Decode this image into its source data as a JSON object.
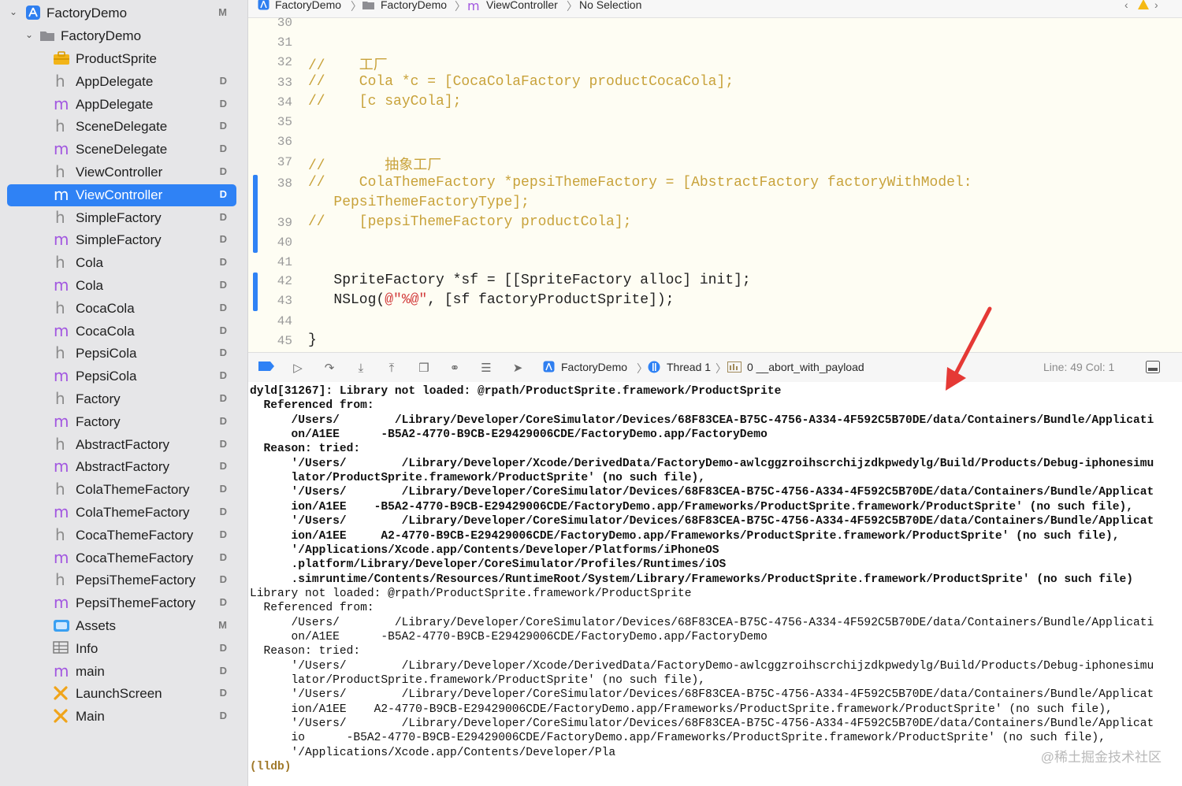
{
  "sidebar": {
    "project": {
      "label": "FactoryDemo",
      "status": "M"
    },
    "group": {
      "label": "FactoryDemo"
    },
    "items": [
      {
        "label": "ProductSprite",
        "kind": "framework",
        "status": ""
      },
      {
        "label": "AppDelegate",
        "kind": "h",
        "status": "D"
      },
      {
        "label": "AppDelegate",
        "kind": "m",
        "status": "D"
      },
      {
        "label": "SceneDelegate",
        "kind": "h",
        "status": "D"
      },
      {
        "label": "SceneDelegate",
        "kind": "m",
        "status": "D"
      },
      {
        "label": "ViewController",
        "kind": "h",
        "status": "D"
      },
      {
        "label": "ViewController",
        "kind": "m",
        "status": "D",
        "selected": true
      },
      {
        "label": "SimpleFactory",
        "kind": "h",
        "status": "D"
      },
      {
        "label": "SimpleFactory",
        "kind": "m",
        "status": "D"
      },
      {
        "label": "Cola",
        "kind": "h",
        "status": "D"
      },
      {
        "label": "Cola",
        "kind": "m",
        "status": "D"
      },
      {
        "label": "CocaCola",
        "kind": "h",
        "status": "D"
      },
      {
        "label": "CocaCola",
        "kind": "m",
        "status": "D"
      },
      {
        "label": "PepsiCola",
        "kind": "h",
        "status": "D"
      },
      {
        "label": "PepsiCola",
        "kind": "m",
        "status": "D"
      },
      {
        "label": "Factory",
        "kind": "h",
        "status": "D"
      },
      {
        "label": "Factory",
        "kind": "m",
        "status": "D"
      },
      {
        "label": "AbstractFactory",
        "kind": "h",
        "status": "D"
      },
      {
        "label": "AbstractFactory",
        "kind": "m",
        "status": "D"
      },
      {
        "label": "ColaThemeFactory",
        "kind": "h",
        "status": "D"
      },
      {
        "label": "ColaThemeFactory",
        "kind": "m",
        "status": "D"
      },
      {
        "label": "CocaThemeFactory",
        "kind": "h",
        "status": "D"
      },
      {
        "label": "CocaThemeFactory",
        "kind": "m",
        "status": "D"
      },
      {
        "label": "PepsiThemeFactory",
        "kind": "h",
        "status": "D"
      },
      {
        "label": "PepsiThemeFactory",
        "kind": "m",
        "status": "D"
      },
      {
        "label": "Assets",
        "kind": "assets",
        "status": "M"
      },
      {
        "label": "Info",
        "kind": "plist",
        "status": "D"
      },
      {
        "label": "main",
        "kind": "m",
        "status": "D"
      },
      {
        "label": "LaunchScreen",
        "kind": "storyboard",
        "status": "D"
      },
      {
        "label": "Main",
        "kind": "storyboard",
        "status": "D"
      }
    ]
  },
  "jumpbar": {
    "crumbs": [
      "FactoryDemo",
      "FactoryDemo",
      "ViewController",
      "No Selection"
    ]
  },
  "editor": {
    "lines": [
      {
        "num": "30",
        "code": ""
      },
      {
        "num": "31",
        "code": ""
      },
      {
        "num": "32",
        "code": "//    工厂",
        "comment": true
      },
      {
        "num": "33",
        "code": "//    Cola *c = [CocaColaFactory productCocaCola];",
        "comment": true
      },
      {
        "num": "34",
        "code": "//    [c sayCola];",
        "comment": true
      },
      {
        "num": "35",
        "code": ""
      },
      {
        "num": "36",
        "code": ""
      },
      {
        "num": "37",
        "code": "//       抽象工厂",
        "comment": true
      },
      {
        "num": "38",
        "code": "//    ColaThemeFactory *pepsiThemeFactory = [AbstractFactory factoryWithModel:",
        "comment": true
      },
      {
        "num": "",
        "code": "   PepsiThemeFactoryType];",
        "comment": true
      },
      {
        "num": "39",
        "code": "//    [pepsiThemeFactory productCola];",
        "comment": true
      },
      {
        "num": "40",
        "code": ""
      },
      {
        "num": "41",
        "code": ""
      },
      {
        "num": "42",
        "code": "   SpriteFactory *sf = [[SpriteFactory alloc] init];"
      },
      {
        "num": "43",
        "code_pre": "   NSLog(",
        "code_str": "@\"%@\"",
        "code_post": ", [sf factoryProductSprite]);"
      },
      {
        "num": "44",
        "code": ""
      },
      {
        "num": "45",
        "code": "}"
      }
    ]
  },
  "debugbar": {
    "target": "FactoryDemo",
    "thread": "Thread 1",
    "frame": "0 __abort_with_payload",
    "position": "Line: 49  Col: 1"
  },
  "console": {
    "lines": [
      {
        "t": "dyld[31267]: Library not loaded: @rpath/ProductSprite.framework/ProductSprite",
        "b": true
      },
      {
        "t": "  Referenced from:",
        "b": true
      },
      {
        "t": "      /Users/        /Library/Developer/CoreSimulator/Devices/68F83CEA-B75C-4756-A334-4F592C5B70DE/data/Containers/Bundle/Applicati",
        "b": true
      },
      {
        "t": "      on/A1EE      -B5A2-4770-B9CB-E29429006CDE/FactoryDemo.app/FactoryDemo",
        "b": true
      },
      {
        "t": "  Reason: tried:",
        "b": true
      },
      {
        "t": "      '/Users/        /Library/Developer/Xcode/DerivedData/FactoryDemo-awlcggzroihscrchijzdkpwedylg/Build/Products/Debug-iphonesimu",
        "b": true
      },
      {
        "t": "      lator/ProductSprite.framework/ProductSprite' (no such file),",
        "b": true
      },
      {
        "t": "      '/Users/        /Library/Developer/CoreSimulator/Devices/68F83CEA-B75C-4756-A334-4F592C5B70DE/data/Containers/Bundle/Applicat",
        "b": true
      },
      {
        "t": "      ion/A1EE    -B5A2-4770-B9CB-E29429006CDE/FactoryDemo.app/Frameworks/ProductSprite.framework/ProductSprite' (no such file),",
        "b": true
      },
      {
        "t": "      '/Users/        /Library/Developer/CoreSimulator/Devices/68F83CEA-B75C-4756-A334-4F592C5B70DE/data/Containers/Bundle/Applicat",
        "b": true
      },
      {
        "t": "      ion/A1EE     A2-4770-B9CB-E29429006CDE/FactoryDemo.app/Frameworks/ProductSprite.framework/ProductSprite' (no such file),",
        "b": true
      },
      {
        "t": "      '/Applications/Xcode.app/Contents/Developer/Platforms/iPhoneOS",
        "b": true
      },
      {
        "t": "      .platform/Library/Developer/CoreSimulator/Profiles/Runtimes/iOS",
        "b": true
      },
      {
        "t": "      .simruntime/Contents/Resources/RuntimeRoot/System/Library/Frameworks/ProductSprite.framework/ProductSprite' (no such file)",
        "b": true
      },
      {
        "t": "Library not loaded: @rpath/ProductSprite.framework/ProductSprite",
        "b": false
      },
      {
        "t": "  Referenced from:",
        "b": false
      },
      {
        "t": "      /Users/        /Library/Developer/CoreSimulator/Devices/68F83CEA-B75C-4756-A334-4F592C5B70DE/data/Containers/Bundle/Applicati",
        "b": false
      },
      {
        "t": "      on/A1EE      -B5A2-4770-B9CB-E29429006CDE/FactoryDemo.app/FactoryDemo",
        "b": false
      },
      {
        "t": "  Reason: tried:",
        "b": false
      },
      {
        "t": "      '/Users/        /Library/Developer/Xcode/DerivedData/FactoryDemo-awlcggzroihscrchijzdkpwedylg/Build/Products/Debug-iphonesimu",
        "b": false
      },
      {
        "t": "      lator/ProductSprite.framework/ProductSprite' (no such file),",
        "b": false
      },
      {
        "t": "      '/Users/        /Library/Developer/CoreSimulator/Devices/68F83CEA-B75C-4756-A334-4F592C5B70DE/data/Containers/Bundle/Applicat",
        "b": false
      },
      {
        "t": "      ion/A1EE    A2-4770-B9CB-E29429006CDE/FactoryDemo.app/Frameworks/ProductSprite.framework/ProductSprite' (no such file),",
        "b": false
      },
      {
        "t": "      '/Users/        /Library/Developer/CoreSimulator/Devices/68F83CEA-B75C-4756-A334-4F592C5B70DE/data/Containers/Bundle/Applicat",
        "b": false
      },
      {
        "t": "      io      -B5A2-4770-B9CB-E29429006CDE/FactoryDemo.app/Frameworks/ProductSprite.framework/ProductSprite' (no such file),",
        "b": false
      },
      {
        "t": "      '/Applications/Xcode.app/Contents/Developer/Pla",
        "b": false
      }
    ],
    "prompt": "(lldb)"
  },
  "watermark": "@稀土掘金技术社区",
  "colors": {
    "accent": "#2f82f5",
    "comment": "#c8a23a",
    "string": "#d23a3a",
    "arrow": "#e53935"
  }
}
